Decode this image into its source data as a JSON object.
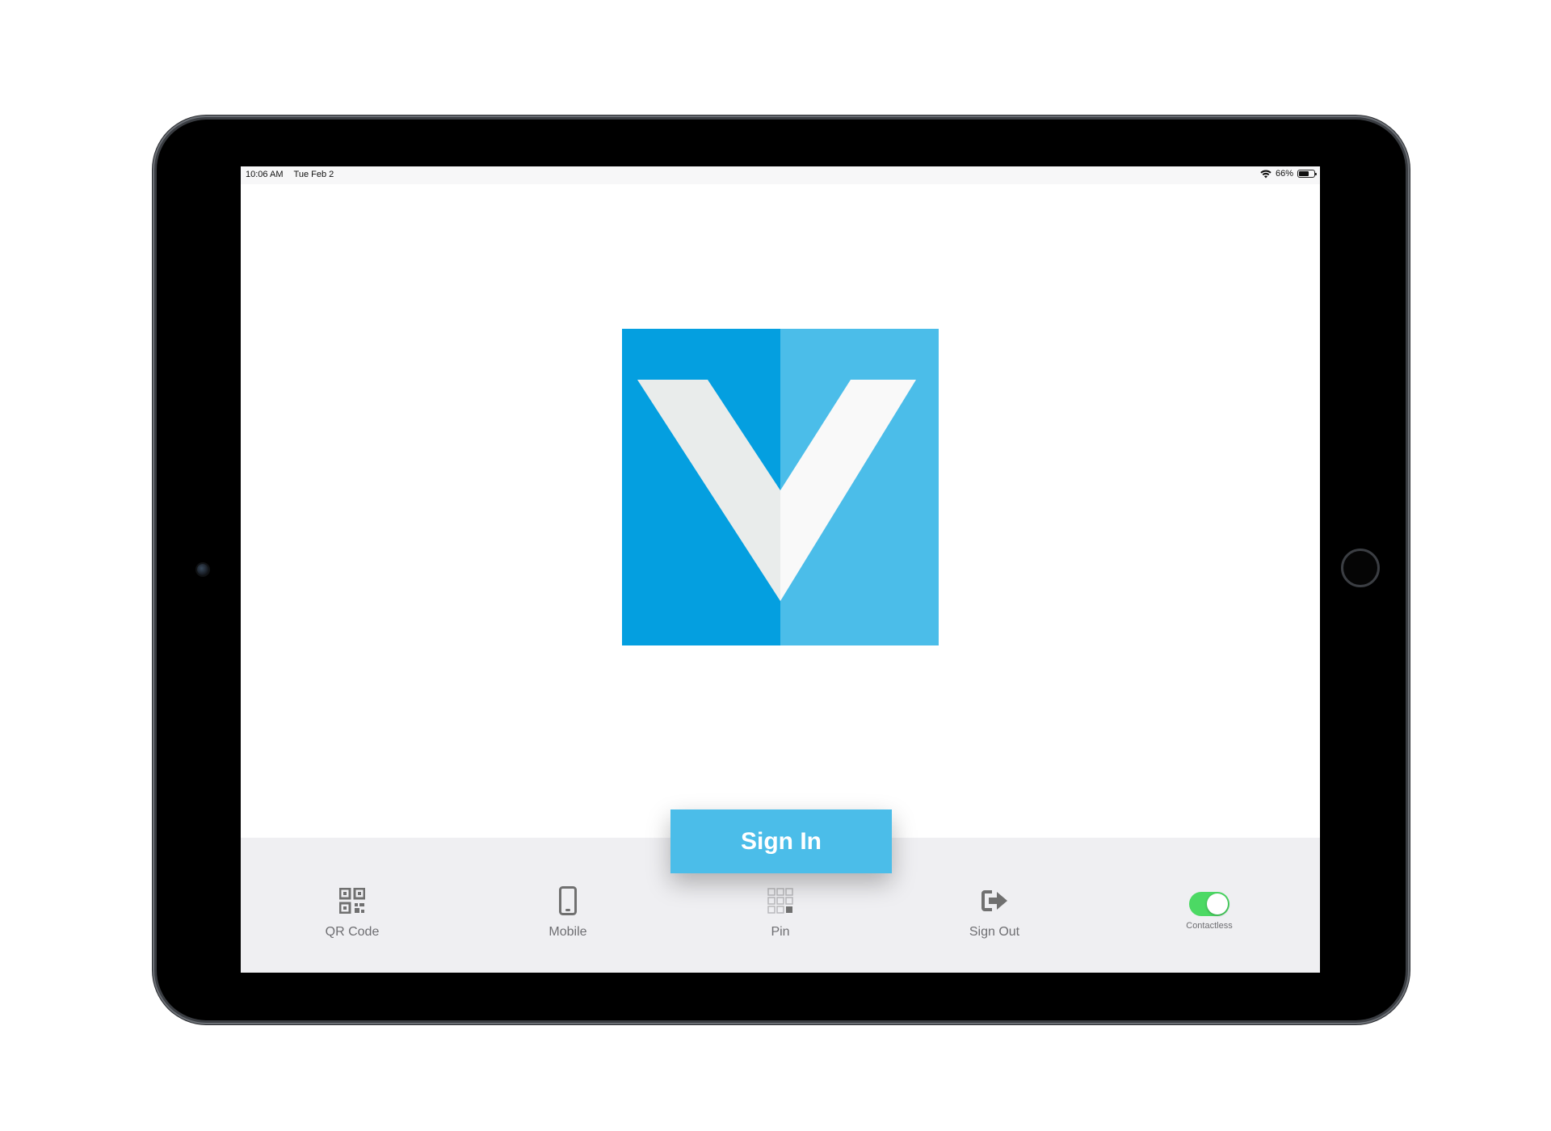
{
  "status_bar": {
    "time": "10:06 AM",
    "date": "Tue Feb 2",
    "battery": "66%",
    "battery_level": 0.66,
    "wifi_icon": "wifi-icon",
    "battery_icon": "battery-icon"
  },
  "logo": {
    "icon": "v-logo",
    "colors": {
      "left": "#049fe0",
      "right": "#4bbde9",
      "v_left": "#e9eceb",
      "v_right": "#f9f9f9"
    }
  },
  "sign_in": {
    "label": "Sign In",
    "color": "#4bbde9"
  },
  "nav": {
    "items": [
      {
        "label": "QR Code",
        "icon": "qr-code-icon"
      },
      {
        "label": "Mobile",
        "icon": "mobile-phone-icon"
      },
      {
        "label": "Pin",
        "icon": "keypad-icon"
      },
      {
        "label": "Sign Out",
        "icon": "sign-out-icon"
      }
    ],
    "toggle": {
      "label": "Contactless",
      "state": "on",
      "color": "#4cd964"
    }
  }
}
